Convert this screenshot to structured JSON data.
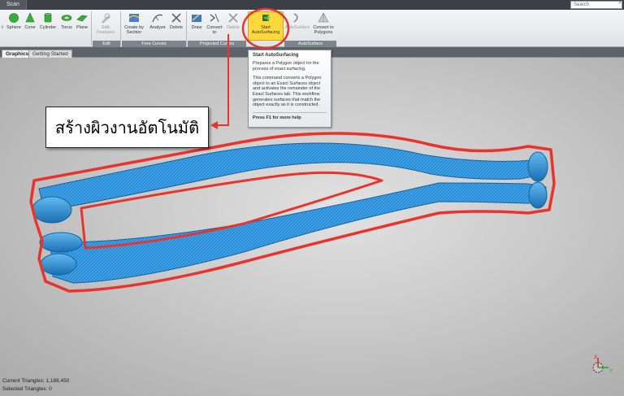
{
  "app": {
    "tab_label": "Scan",
    "search_placeholder": "Search"
  },
  "ribbon": {
    "buttons": {
      "t_label": "t",
      "sphere": "Sphere",
      "cone": "Cone",
      "cylinder": "Cylinder",
      "torus": "Torus",
      "plane": "Plane",
      "edit_features_1": "Edit",
      "edit_features_2": "Features",
      "create_by_section_1": "Create by",
      "create_by_section_2": "Section",
      "analyze": "Analyze",
      "delete_1": "Delete",
      "draw": "Draw",
      "convert_to_1": "Convert",
      "convert_to_2": "to",
      "delete_2": "Delete",
      "start_autosurfacing_1": "Start",
      "start_autosurfacing_2": "AutoSurfacing",
      "autosurface": "AutoSurface",
      "convert_to_polygons_1": "Convert to",
      "convert_to_polygons_2": "Polygons"
    },
    "groups": {
      "edit": "Edit",
      "free_curves": "Free Curves",
      "projected_curves": "Projected Curves",
      "autosurface": "AutoSurface"
    }
  },
  "doc_tabs": {
    "graphics": "Graphics",
    "getting_started": "Getting Started"
  },
  "tooltip": {
    "title": "Start AutoSurfacing",
    "line1": "Prepares a Polygon object for the process of exact surfacing.",
    "line2": "This command converts a Polygon object to an Exact Surfaces object and activates the remainder of the Exact Surfaces tab. This workflow generates surfaces that match the object exactly as it is constructed.",
    "help": "Press F1 for more help"
  },
  "callout": {
    "text": "สร้างผิวงานอัตโนมัติ"
  },
  "status": {
    "current_triangles": "Current Triangles: 1,188,450",
    "selected_triangles": "Selected Triangles: 0"
  },
  "triad": {
    "x": "X",
    "y": "Y"
  },
  "colors": {
    "highlight_red": "#e8342c",
    "highlight_yellow": "#ffd83b",
    "mesh_blue": "#2a8fd8"
  }
}
